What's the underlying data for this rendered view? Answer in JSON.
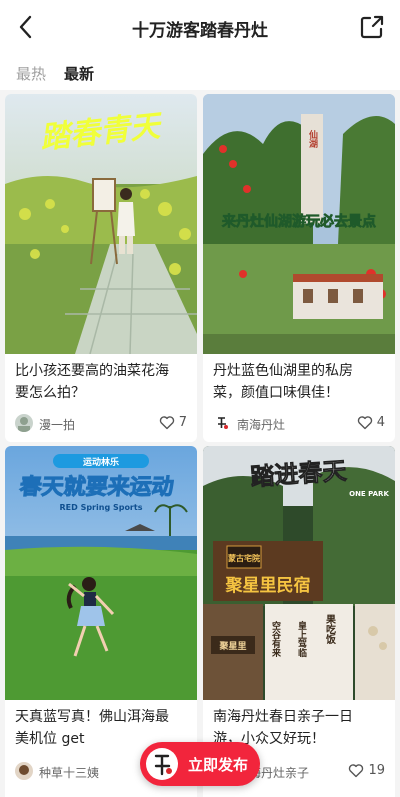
{
  "header": {
    "title": "十万游客踏春丹灶",
    "back_icon": "chevron-left-icon",
    "share_icon": "share-icon"
  },
  "tabs": [
    {
      "label": "最热",
      "active": false
    },
    {
      "label": "最新",
      "active": true
    }
  ],
  "cards": [
    {
      "image_text": "踏春青天",
      "title_line1": "比小孩还要高的油菜花海",
      "title_line2": "要怎么拍？",
      "author": "漫一拍",
      "likes": "7"
    },
    {
      "image_text": "来丹灶仙湖游玩必去景点",
      "image_sign": "仙湖",
      "title_line1": "丹灶蓝色仙湖里的私房",
      "title_line2": "菜，颜值口味俱佳！",
      "author": "南海丹灶",
      "likes": "4"
    },
    {
      "image_badge": "运动林乐",
      "image_headline": "春天就要来运动",
      "image_sub": "RED Spring Sports",
      "title_line1": "天真蓝写真！佛山洱海最",
      "title_line2": "美机位 get",
      "author": "种草十三姨"
    },
    {
      "image_headline": "踏进春天",
      "image_tag": "ONE PARK",
      "sign_top": "蒙古宅院",
      "sign_main": "聚星里民宿",
      "sign_small": "聚星里",
      "banner1": "空谷有来",
      "banner2": "皇上驾临",
      "banner3": "果吃饭",
      "title_line1": "南海丹灶春日亲子一日",
      "title_line2": "游，小众又好玩！",
      "author": "南海丹灶亲子",
      "likes": "19"
    }
  ],
  "fab": {
    "label": "立即发布"
  },
  "colors": {
    "accent": "#f2253c",
    "text": "#222222",
    "muted": "#a0a0a0"
  }
}
